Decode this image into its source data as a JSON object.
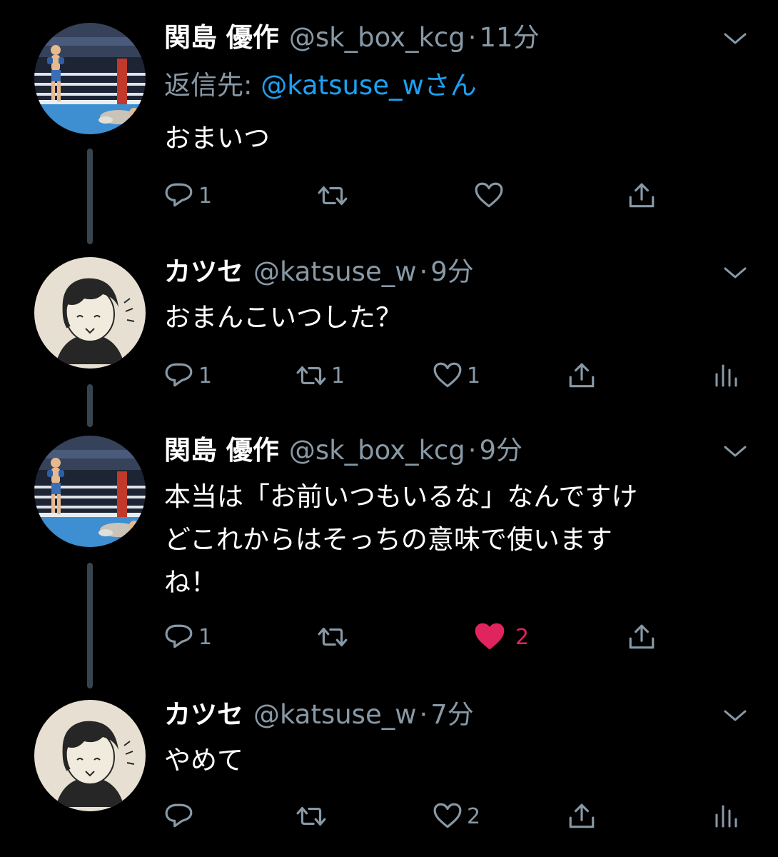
{
  "tweets": [
    {
      "display_name": "関島 優作",
      "handle": "@sk_box_kcg",
      "separator": "·",
      "time": "11分",
      "reply_label": "返信先: ",
      "reply_mention": "@katsuse_wさん",
      "text": "おまいつ",
      "avatar": "boxing-ring-photo",
      "reply_count": "1",
      "retweet_count": "",
      "like_count": "",
      "liked": false,
      "show_analytics": false
    },
    {
      "display_name": "カツセ",
      "handle": "@katsuse_w",
      "separator": "·",
      "time": "9分",
      "text": "おまんこいつした？",
      "avatar": "illustrated-person",
      "reply_count": "1",
      "retweet_count": "1",
      "like_count": "1",
      "liked": false,
      "show_analytics": true
    },
    {
      "display_name": "関島 優作",
      "handle": "@sk_box_kcg",
      "separator": "·",
      "time": "9分",
      "text_lines": [
        "本当は「お前いつもいるな」なんですけ",
        "どこれからはそっちの意味で使います",
        "ね！"
      ],
      "avatar": "boxing-ring-photo",
      "reply_count": "1",
      "retweet_count": "",
      "like_count": "2",
      "liked": true,
      "show_analytics": false
    },
    {
      "display_name": "カツセ",
      "handle": "@katsuse_w",
      "separator": "·",
      "time": "7分",
      "text": "やめて",
      "avatar": "illustrated-person",
      "reply_count": "",
      "retweet_count": "",
      "like_count": "2",
      "liked": false,
      "show_analytics": true
    }
  ],
  "colors": {
    "background": "#000000",
    "text_primary": "#ffffff",
    "text_secondary": "#8899a6",
    "link": "#1da1f2",
    "like": "#e0245e",
    "thread_line": "#38444d"
  },
  "icons": [
    "chevron-down-icon",
    "reply-icon",
    "retweet-icon",
    "like-icon",
    "share-icon",
    "analytics-icon"
  ]
}
